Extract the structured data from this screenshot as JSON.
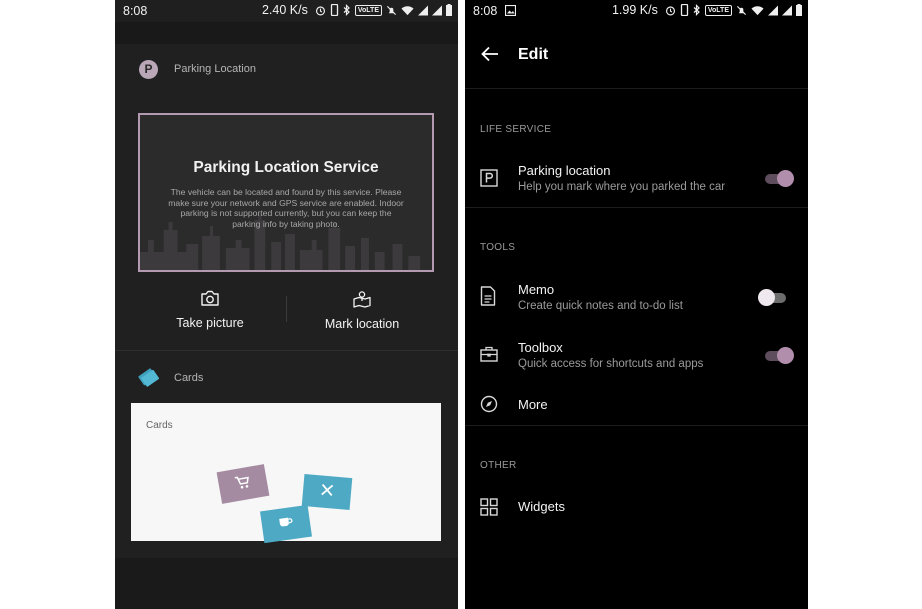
{
  "left": {
    "status": {
      "time": "8:08",
      "speed": "2.40 K/s",
      "volte": "VoLTE"
    },
    "parking_header": {
      "badge": "P",
      "title": "Parking Location"
    },
    "parking_card": {
      "title": "Parking Location Service",
      "description": "The vehicle can be located and found by this service. Please make sure your network and GPS service are enabled. Indoor parking is not supported currently, but you can keep the parking info by taking photo."
    },
    "actions": {
      "take_picture": "Take picture",
      "mark_location": "Mark location"
    },
    "cards_header": {
      "title": "Cards"
    },
    "cards_panel": {
      "title": "Cards"
    }
  },
  "right": {
    "status": {
      "time": "8:08",
      "speed": "1.99 K/s",
      "volte": "VoLTE"
    },
    "appbar": {
      "title": "Edit"
    },
    "sections": {
      "life_service": "LIFE SERVICE",
      "tools": "TOOLS",
      "other": "OTHER"
    },
    "items": {
      "parking": {
        "title": "Parking location",
        "subtitle": "Help you mark where you parked the car",
        "enabled": true
      },
      "memo": {
        "title": "Memo",
        "subtitle": "Create quick notes and to-do list",
        "enabled": false
      },
      "toolbox": {
        "title": "Toolbox",
        "subtitle": "Quick access for shortcuts and apps",
        "enabled": true
      },
      "more": {
        "title": "More"
      },
      "widgets": {
        "title": "Widgets"
      }
    }
  },
  "colors": {
    "accent": "#b28ead",
    "card_blue": "#4ea9c4",
    "card_mauve": "#a58ba1"
  }
}
